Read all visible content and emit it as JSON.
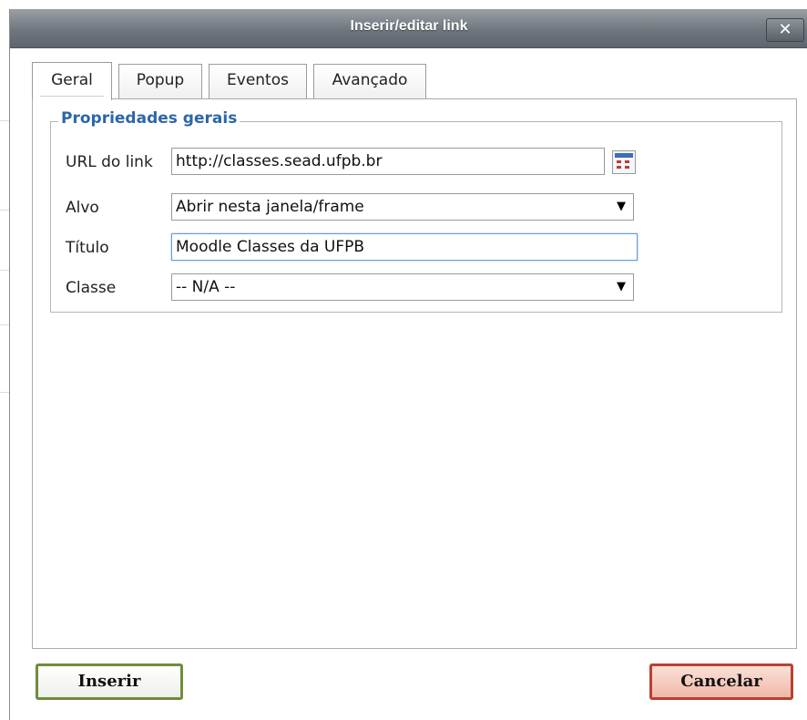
{
  "dialog": {
    "title": "Inserir/editar link",
    "close_label": "✕"
  },
  "tabs": [
    {
      "label": "Geral",
      "active": true
    },
    {
      "label": "Popup",
      "active": false
    },
    {
      "label": "Eventos",
      "active": false
    },
    {
      "label": "Avançado",
      "active": false
    }
  ],
  "general": {
    "legend": "Propriedades gerais",
    "url_label": "URL do link",
    "url_value": "http://classes.sead.ufpb.br",
    "target_label": "Alvo",
    "target_value": "Abrir nesta janela/frame",
    "title_label": "Título",
    "title_value": "Moodle Classes da UFPB",
    "class_label": "Classe",
    "class_value": "-- N/A --",
    "dropdown_arrow": "▼",
    "browse_icon": "browse-icon"
  },
  "buttons": {
    "insert_label": "Inserir",
    "cancel_label": "Cancelar"
  },
  "colors": {
    "legend": "#2d66a8",
    "insert_border": "#6f8d3b",
    "cancel_border": "#b9412f"
  }
}
